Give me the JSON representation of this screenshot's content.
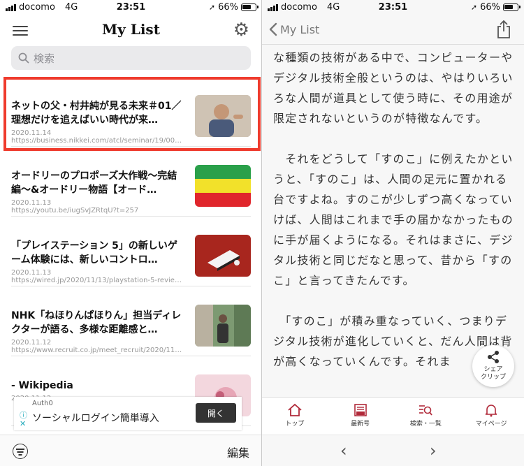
{
  "left": {
    "status": {
      "carrier": "docomo",
      "network": "4G",
      "time": "23:51",
      "battery": "66%"
    },
    "nav": {
      "title": "My List",
      "menu_icon": "hamburger-icon",
      "settings_icon": "gear-icon"
    },
    "search": {
      "placeholder": "検索"
    },
    "items": [
      {
        "title": "ネットの父・村井純が見る未来＃01／理想だけを追えばいい時代が来…",
        "date": "2020.11.14",
        "url": "https://business.nikkei.com/atcl/seminar/19/0001…",
        "thumb": "person-photo"
      },
      {
        "title": "オードリーのプロポーズ大作戦〜完結編〜&オードリー物語【オード…",
        "date": "2020.11.13",
        "url": "https://youtu.be/iugSvJZRtqU?t=257",
        "thumb": "stripes"
      },
      {
        "title": "「プレイステーション 5」の新しいゲーム体験には、新しいコントロ…",
        "date": "2020.11.13",
        "url": "https://wired.jp/2020/11/13/playstation-5-review/",
        "thumb": "ps5"
      },
      {
        "title": "NHK「ねほりんぱほりん」担当ディレクターが語る、多様な距離感と…",
        "date": "2020.11.12",
        "url": "https://www.recruit.co.jp/meet_recruit/2020/11/n…",
        "thumb": "person-outdoor"
      },
      {
        "title": "- Wikipedia",
        "date": "2020.11.12",
        "url": "",
        "thumb": "pink-cover"
      }
    ],
    "ad": {
      "brand": "Auth0",
      "text": "ソーシャルログイン簡単導入",
      "button": "開く"
    },
    "bottom": {
      "edit": "編集"
    },
    "colors": {
      "highlight": "#ef3b2d"
    }
  },
  "right": {
    "status": {
      "carrier": "docomo",
      "network": "4G",
      "time": "23:51",
      "battery": "66%"
    },
    "nav": {
      "back_label": "My List"
    },
    "article": [
      "な種類の技術がある中で、コンピューターやデジタル技術全般というのは、やはりいろいろな人間が道具として使う時に、その用途が限定されないというのが特徴なんです。",
      "　それをどうして「すのこ」に例えたかというと、「すのこ」は、人間の足元に置かれる台ですよね。すのこが少しずつ高くなっていけば、人間はこれまで手の届かなかったものに手が届くようになる。それはまさに、デジタル技術と同じだなと思って、昔から「すのこ」と言ってきたんです。",
      "　「すのこ」が積み重なっていく、つまりデジタル技術が進化していくと、だん人間は背が高くなっていくんです。それま"
    ],
    "float_share": {
      "line1": "シェア",
      "line2": "クリップ"
    },
    "tabs": [
      {
        "label": "トップ",
        "icon": "home-icon"
      },
      {
        "label": "最新号",
        "icon": "new-issue-icon"
      },
      {
        "label": "検索・一覧",
        "icon": "search-list-icon"
      },
      {
        "label": "マイページ",
        "icon": "bell-icon"
      }
    ],
    "colors": {
      "accent": "#b12a3a"
    }
  }
}
